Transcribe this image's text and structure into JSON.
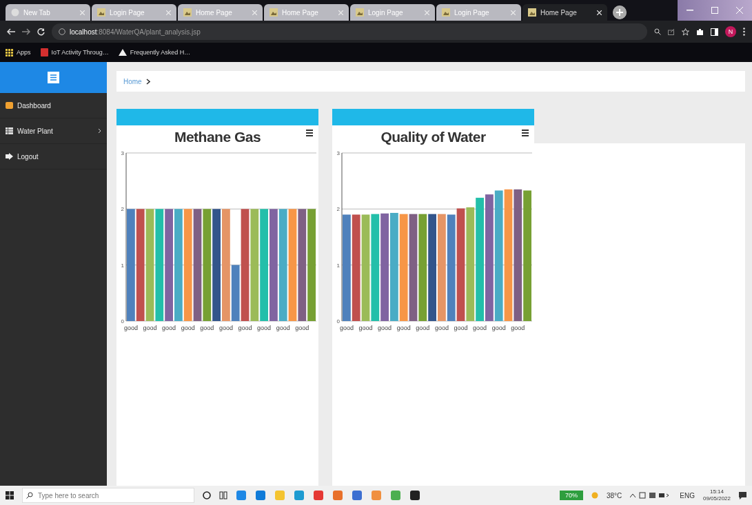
{
  "browser": {
    "tabs": [
      {
        "title": "New Tab",
        "kind": "newtab",
        "selected": false
      },
      {
        "title": "Login Page",
        "kind": "page",
        "selected": false
      },
      {
        "title": "Home Page",
        "kind": "page",
        "selected": false
      },
      {
        "title": "Home Page",
        "kind": "page",
        "selected": false
      },
      {
        "title": "Login Page",
        "kind": "page",
        "selected": false
      },
      {
        "title": "Login Page",
        "kind": "page",
        "selected": false
      },
      {
        "title": "Home Page",
        "kind": "page",
        "selected": true
      }
    ],
    "address": {
      "host": "localhost",
      "path": ":8084/WaterQA/plant_analysis.jsp"
    },
    "profile_initial": "N",
    "bookmarks": [
      {
        "label": "Apps",
        "kind": "apps"
      },
      {
        "label": "IoT Activity Throug…",
        "kind": "red"
      },
      {
        "label": "Frequently Asked H…",
        "kind": "drive"
      }
    ]
  },
  "sidebar": {
    "items": [
      {
        "label": "Dashboard",
        "kind": "dashboard",
        "has_children": false
      },
      {
        "label": "Water Plant",
        "kind": "table",
        "has_children": true
      },
      {
        "label": "Logout",
        "kind": "logout",
        "has_children": false
      }
    ]
  },
  "breadcrumb": [
    "Home"
  ],
  "charts": [
    {
      "chart_data": {
        "type": "bar",
        "title": "Methane Gas",
        "categories": [
          "good",
          null,
          "good",
          null,
          "good",
          null,
          "good",
          null,
          "good",
          null,
          "good",
          null,
          "good",
          null,
          "good",
          null,
          "good",
          null,
          "good",
          null
        ],
        "ylim": [
          0,
          3
        ],
        "yticks": [
          0,
          1,
          2,
          3
        ],
        "series": [
          {
            "colors": [
              "#4f81bc",
              "#c0504e",
              "#9bbb58",
              "#23bfaa",
              "#8064a1",
              "#4aacc5",
              "#f79647",
              "#7f6084",
              "#77a033",
              "#33558b",
              "#e59566",
              "#4f81bc",
              "#c0504e",
              "#9bbb58",
              "#23bfaa",
              "#8064a1",
              "#4aacc5",
              "#f79647",
              "#7f6084",
              "#77a033"
            ],
            "values": [
              2,
              2,
              2,
              2,
              2,
              2,
              2,
              2,
              2,
              2,
              2,
              1,
              2,
              2,
              2,
              2,
              2,
              2,
              2,
              2
            ]
          }
        ]
      }
    },
    {
      "chart_data": {
        "type": "bar",
        "title": "Quality of Water",
        "categories": [
          "good",
          null,
          "good",
          null,
          "good",
          null,
          "good",
          null,
          "good",
          null,
          "good",
          null,
          "good",
          null,
          "good",
          null,
          "good",
          null,
          "good",
          null
        ],
        "ylim": [
          0,
          3
        ],
        "yticks": [
          0,
          1,
          2,
          3
        ],
        "series": [
          {
            "colors": [
              "#4f81bc",
              "#c0504e",
              "#9bbb58",
              "#23bfaa",
              "#8064a1",
              "#4aacc5",
              "#f79647",
              "#7f6084",
              "#77a033",
              "#33558b",
              "#e59566",
              "#4f81bc",
              "#c0504e",
              "#9bbb58",
              "#23bfaa",
              "#8064a1",
              "#4aacc5",
              "#f79647",
              "#7f6084",
              "#77a033"
            ],
            "values": [
              1.9,
              1.9,
              1.9,
              1.91,
              1.92,
              1.93,
              1.91,
              1.91,
              1.91,
              1.91,
              1.91,
              1.9,
              2.01,
              2.03,
              2.2,
              2.26,
              2.33,
              2.35,
              2.35,
              2.33
            ]
          }
        ]
      }
    }
  ],
  "taskbar": {
    "search": {
      "placeholder": "Type here to search"
    },
    "battery": "70%",
    "weather": "38°C",
    "language": "ENG",
    "time": "15:14",
    "date": "09/05/2022"
  }
}
